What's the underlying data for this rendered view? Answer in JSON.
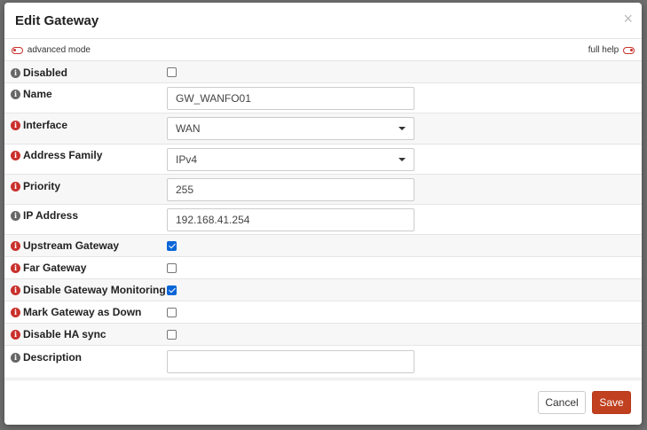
{
  "modal": {
    "title": "Edit Gateway",
    "close_symbol": "×"
  },
  "mode_bar": {
    "advanced_mode_label": "advanced mode",
    "full_help_label": "full help"
  },
  "fields": {
    "disabled": {
      "label": "Disabled",
      "checked": false,
      "info_color": "grey"
    },
    "name": {
      "label": "Name",
      "value": "GW_WANFO01",
      "info_color": "grey"
    },
    "interface": {
      "label": "Interface",
      "value": "WAN",
      "info_color": "orange"
    },
    "address_family": {
      "label": "Address Family",
      "value": "IPv4",
      "info_color": "orange"
    },
    "priority": {
      "label": "Priority",
      "value": "255",
      "info_color": "orange"
    },
    "ip_address": {
      "label": "IP Address",
      "value": "192.168.41.254",
      "info_color": "grey"
    },
    "upstream_gateway": {
      "label": "Upstream Gateway",
      "checked": true,
      "info_color": "orange"
    },
    "far_gateway": {
      "label": "Far Gateway",
      "checked": false,
      "info_color": "orange"
    },
    "disable_monitoring": {
      "label": "Disable Gateway Monitoring",
      "checked": true,
      "info_color": "orange"
    },
    "mark_down": {
      "label": "Mark Gateway as Down",
      "checked": false,
      "info_color": "orange"
    },
    "disable_ha_sync": {
      "label": "Disable HA sync",
      "checked": false,
      "info_color": "orange"
    },
    "description": {
      "label": "Description",
      "value": "",
      "info_color": "grey"
    }
  },
  "info_icon_glyph": "i",
  "footer": {
    "cancel_label": "Cancel",
    "save_label": "Save"
  },
  "colors": {
    "accent": "#c0401f",
    "checkbox_checked": "#0a66d8",
    "info_orange": "#c9302c",
    "info_grey": "#666666"
  }
}
